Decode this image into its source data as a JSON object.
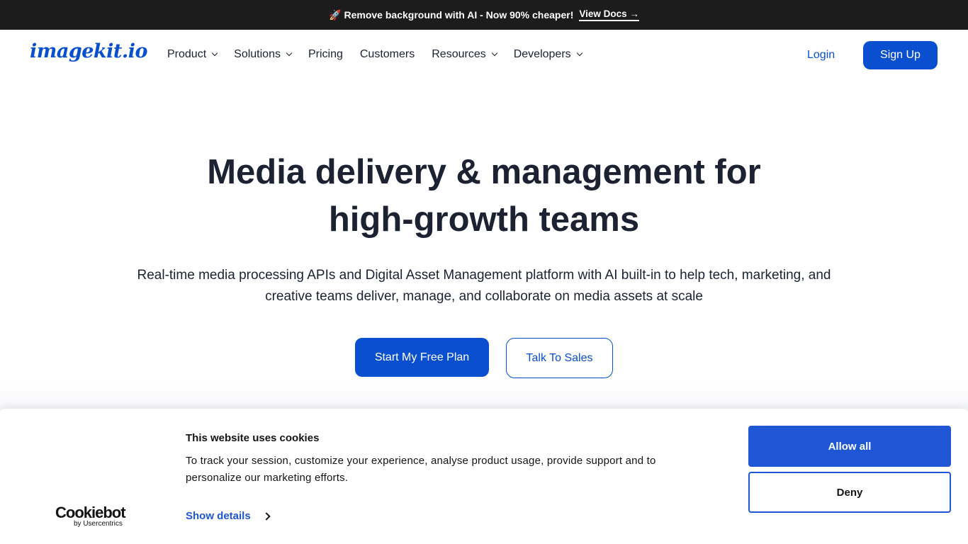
{
  "announcement": {
    "icon": "rocket-icon",
    "text": "Remove background with AI - Now 90% cheaper!",
    "link_label": "View Docs →"
  },
  "header": {
    "logo": "imagekit.io",
    "nav": [
      {
        "label": "Product",
        "dropdown": true
      },
      {
        "label": "Solutions",
        "dropdown": true
      },
      {
        "label": "Pricing",
        "dropdown": false
      },
      {
        "label": "Customers",
        "dropdown": false
      },
      {
        "label": "Resources",
        "dropdown": true
      },
      {
        "label": "Developers",
        "dropdown": true
      }
    ],
    "login_label": "Login",
    "signup_label": "Sign Up"
  },
  "hero": {
    "title_line1": "Media delivery & management for",
    "title_line2": "high-growth teams",
    "subtitle_line1": "Real-time media processing APIs and Digital Asset Management platform with AI built-in to help tech, marketing, and",
    "subtitle_line2": "creative teams deliver, manage, and collaborate on media assets at scale",
    "primary_cta": "Start My Free Plan",
    "secondary_cta": "Talk To Sales"
  },
  "cookie_banner": {
    "brand": "Cookiebot",
    "brand_by": "by Usercentrics",
    "title": "This website uses cookies",
    "text": "To track your session, customize your experience, analyse product usage, provide support and to personalize our marketing efforts.",
    "show_details": "Show details",
    "allow_label": "Allow all",
    "deny_label": "Deny"
  },
  "colors": {
    "brand_blue": "#0a4fd0",
    "cookie_blue": "#1f56d6",
    "announcement_bg": "#1c1c1c",
    "text_dark": "#1c2232"
  }
}
